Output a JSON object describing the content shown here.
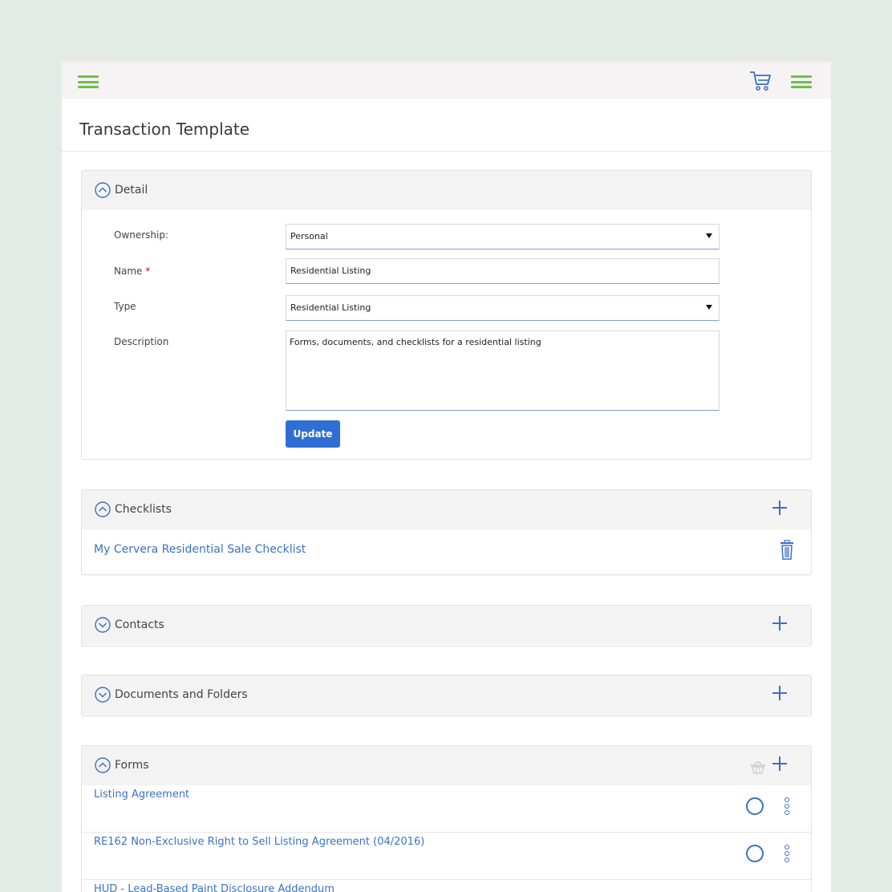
{
  "page": {
    "title": "Transaction Template"
  },
  "colors": {
    "accent_green": "#6cc04a",
    "link_blue": "#3a72c4",
    "button_blue": "#2f6fd3",
    "required_red": "#d0021b"
  },
  "icons": {
    "menu_left": "hamburger-icon",
    "cart": "cart-icon",
    "menu_right": "hamburger-icon"
  },
  "detail": {
    "title": "Detail",
    "expanded": true,
    "ownership_label": "Ownership:",
    "ownership_value": "Personal",
    "name_label": "Name",
    "name_required": "*",
    "name_value": "Residential Listing",
    "type_label": "Type",
    "type_value": "Residential Listing",
    "description_label": "Description",
    "description_value": "Forms, documents, and checklists for a residential listing",
    "update_label": "Update"
  },
  "checklists": {
    "title": "Checklists",
    "expanded": true,
    "items": [
      {
        "label": "My Cervera Residential Sale Checklist"
      }
    ]
  },
  "contacts": {
    "title": "Contacts",
    "expanded": false
  },
  "documents": {
    "title": "Documents and Folders",
    "expanded": false
  },
  "forms": {
    "title": "Forms",
    "expanded": true,
    "items": [
      {
        "label": "Listing Agreement"
      },
      {
        "label": "RE162 Non-Exclusive Right to Sell Listing Agreement (04/2016)"
      },
      {
        "label": "HUD - Lead-Based Paint Disclosure Addendum"
      }
    ]
  }
}
